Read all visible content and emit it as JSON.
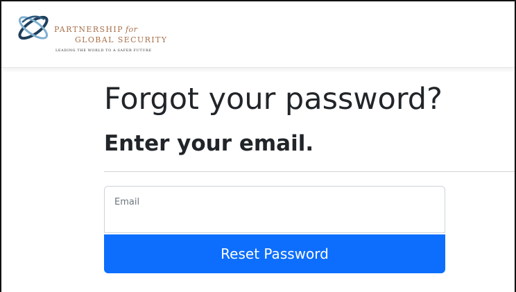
{
  "header": {
    "logo": {
      "name_line1": "PARTNERSHIP",
      "name_for": "for",
      "name_line2": "GLOBAL SECURITY",
      "tagline": "LEADING THE WORLD TO A SAFER FUTURE"
    }
  },
  "main": {
    "title": "Forgot your password?",
    "subtitle": "Enter your email.",
    "email": {
      "label": "Email",
      "value": ""
    },
    "submit_label": "Reset Password"
  },
  "colors": {
    "primary_button": "#0d6efd",
    "logo_text": "#a86f49",
    "logo_globe_dark": "#1f3f5b",
    "logo_globe_light": "#7fb0cf"
  }
}
